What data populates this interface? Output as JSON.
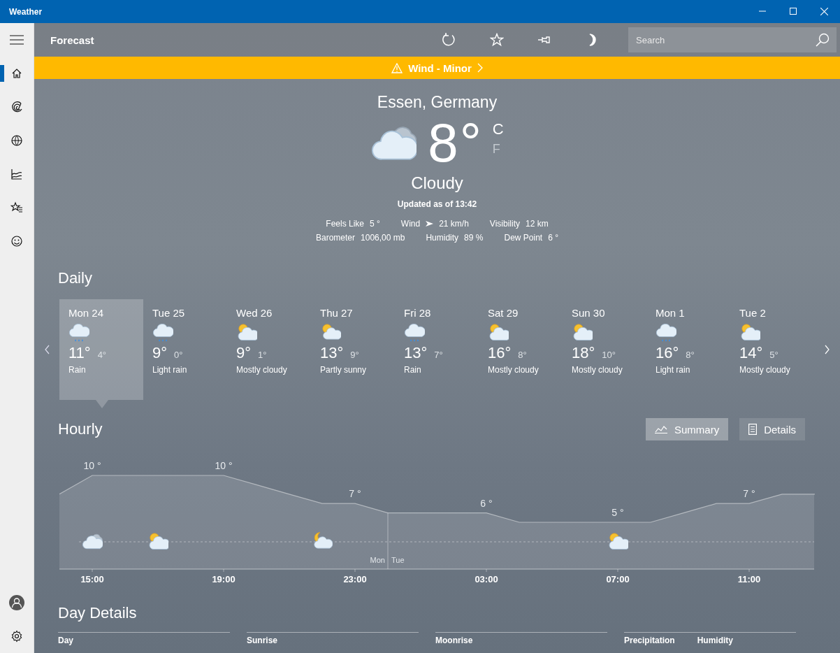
{
  "window": {
    "title": "Weather"
  },
  "sidebar": {
    "items": [
      {
        "kind": "home",
        "selected": true
      },
      {
        "kind": "radar",
        "selected": false
      },
      {
        "kind": "globe",
        "selected": false
      },
      {
        "kind": "chart",
        "selected": false
      },
      {
        "kind": "favorites",
        "selected": false
      },
      {
        "kind": "smiley",
        "selected": false
      }
    ],
    "bottom": [
      {
        "kind": "account"
      },
      {
        "kind": "settings"
      }
    ]
  },
  "toolbar": {
    "title": "Forecast",
    "actions": [
      {
        "kind": "refresh"
      },
      {
        "kind": "star"
      },
      {
        "kind": "pin"
      },
      {
        "kind": "moon"
      }
    ],
    "search": {
      "placeholder": "Search"
    }
  },
  "alert": {
    "text": "Wind - Minor"
  },
  "current": {
    "location": "Essen, Germany",
    "kind": "cloudy",
    "temperature": "8°",
    "units": [
      {
        "label": "C",
        "selected": true
      },
      {
        "label": "F",
        "selected": false
      }
    ],
    "condition": "Cloudy",
    "updated": "Updated as of 13:42",
    "stats": [
      [
        {
          "label": "Feels Like",
          "value": "5 °",
          "kind": "plain"
        },
        {
          "label": "Wind",
          "value": "21 km/h",
          "kind": "wind"
        },
        {
          "label": "Visibility",
          "value": "12 km",
          "kind": "plain"
        }
      ],
      [
        {
          "label": "Barometer",
          "value": "1006,00 mb",
          "kind": "plain"
        },
        {
          "label": "Humidity",
          "value": "89 %",
          "kind": "plain"
        },
        {
          "label": "Dew Point",
          "value": "6 °",
          "kind": "plain"
        }
      ]
    ]
  },
  "daily": {
    "title": "Daily",
    "days": [
      {
        "day": "Mon 24",
        "kind": "rain",
        "high": "11°",
        "low": "4°",
        "summary": "Rain",
        "selected": true
      },
      {
        "day": "Tue 25",
        "kind": "rain",
        "high": "9°",
        "low": "0°",
        "summary": "Light rain",
        "selected": false
      },
      {
        "day": "Wed 26",
        "kind": "partly-cloudy",
        "high": "9°",
        "low": "1°",
        "summary": "Mostly cloudy",
        "selected": false
      },
      {
        "day": "Thu 27",
        "kind": "partly-sunny",
        "high": "13°",
        "low": "9°",
        "summary": "Partly sunny",
        "selected": false
      },
      {
        "day": "Fri 28",
        "kind": "rain",
        "high": "13°",
        "low": "7°",
        "summary": "Rain",
        "selected": false
      },
      {
        "day": "Sat 29",
        "kind": "partly-cloudy",
        "high": "16°",
        "low": "8°",
        "summary": "Mostly cloudy",
        "selected": false
      },
      {
        "day": "Sun 30",
        "kind": "partly-cloudy",
        "high": "18°",
        "low": "10°",
        "summary": "Mostly cloudy",
        "selected": false
      },
      {
        "day": "Mon 1",
        "kind": "rain",
        "high": "16°",
        "low": "8°",
        "summary": "Light rain",
        "selected": false
      },
      {
        "day": "Tue 2",
        "kind": "partly-cloudy",
        "high": "14°",
        "low": "5°",
        "summary": "Mostly cloudy",
        "selected": false
      }
    ]
  },
  "hourly": {
    "title": "Hourly",
    "views": [
      {
        "label": "Summary",
        "kind": "chart",
        "selected": true
      },
      {
        "label": "Details",
        "kind": "list",
        "selected": false
      }
    ],
    "temperature_labels": [
      "10 °",
      "10 °",
      "7 °",
      "6 °",
      "5 °",
      "7 °"
    ],
    "time_labels": [
      "15:00",
      "19:00",
      "23:00",
      "03:00",
      "07:00",
      "11:00"
    ],
    "conditions": [
      {
        "kind": "cloudy"
      },
      {
        "kind": "partly-cloudy"
      },
      {
        "kind": "night-partly-cloudy"
      },
      {
        "kind": "partly-cloudy"
      }
    ],
    "day_split": {
      "before": "Mon",
      "after": "Tue"
    }
  },
  "day_details": {
    "title": "Day Details",
    "sections": [
      [
        "Day"
      ],
      [
        "Sunrise"
      ],
      [
        "Moonrise"
      ],
      [
        "Precipitation",
        "Humidity"
      ]
    ]
  }
}
